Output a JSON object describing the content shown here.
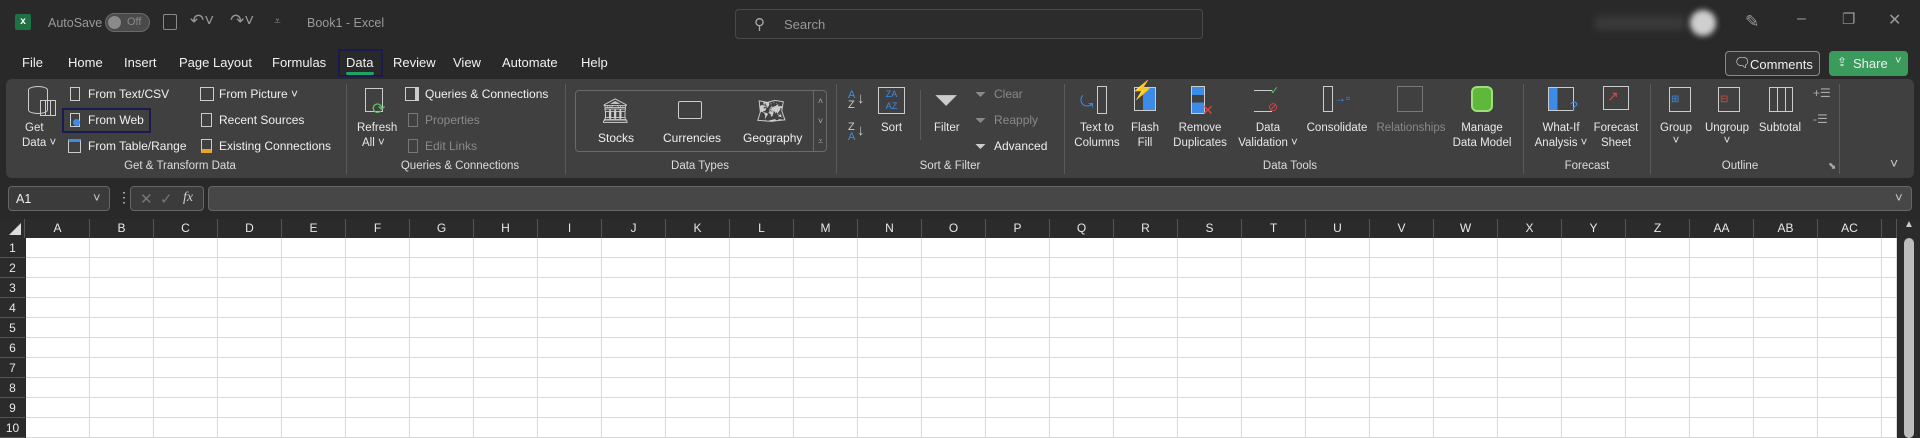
{
  "titlebar": {
    "autosave_label": "AutoSave",
    "autosave_state": "Off",
    "title": "Book1  -  Excel",
    "search_placeholder": "Search"
  },
  "menu": {
    "tabs": [
      "File",
      "Home",
      "Insert",
      "Page Layout",
      "Formulas",
      "Data",
      "Review",
      "View",
      "Automate",
      "Help"
    ],
    "active": "Data",
    "comments": "Comments",
    "share": "Share"
  },
  "ribbon": {
    "get_transform": {
      "get_data": [
        "Get",
        "Data ˅"
      ],
      "from_text_csv": "From Text/CSV",
      "from_web": "From Web",
      "from_table": "From Table/Range",
      "from_picture": "From Picture ˅",
      "recent_sources": "Recent Sources",
      "existing_connections": "Existing Connections",
      "label": "Get & Transform Data"
    },
    "queries": {
      "refresh": [
        "Refresh",
        "All ˅"
      ],
      "queries_connections": "Queries & Connections",
      "properties": "Properties",
      "edit_links": "Edit Links",
      "label": "Queries & Connections"
    },
    "data_types": {
      "stocks": "Stocks",
      "currencies": "Currencies",
      "geography": "Geography",
      "label": "Data Types"
    },
    "sort_filter": {
      "sort": "Sort",
      "filter": "Filter",
      "clear": "Clear",
      "reapply": "Reapply",
      "advanced": "Advanced",
      "label": "Sort & Filter"
    },
    "data_tools": {
      "text_to_columns": [
        "Text to",
        "Columns"
      ],
      "flash_fill": [
        "Flash",
        "Fill"
      ],
      "remove_duplicates": [
        "Remove",
        "Duplicates"
      ],
      "data_validation": [
        "Data",
        "Validation ˅"
      ],
      "consolidate": "Consolidate",
      "relationships": "Relationships",
      "manage_data_model": [
        "Manage",
        "Data Model"
      ],
      "label": "Data Tools"
    },
    "forecast": {
      "what_if": [
        "What-If",
        "Analysis ˅"
      ],
      "forecast_sheet": [
        "Forecast",
        "Sheet"
      ],
      "label": "Forecast"
    },
    "outline": {
      "group": [
        "Group",
        "˅"
      ],
      "ungroup": [
        "Ungroup",
        "˅"
      ],
      "subtotal": "Subtotal",
      "label": "Outline"
    }
  },
  "formula_bar": {
    "name_box": "A1",
    "fx": "fx",
    "value": ""
  },
  "grid": {
    "columns": [
      "A",
      "B",
      "C",
      "D",
      "E",
      "F",
      "G",
      "H",
      "I",
      "J",
      "K",
      "L",
      "M",
      "N",
      "O",
      "P",
      "Q",
      "R",
      "S",
      "T",
      "U",
      "V",
      "W",
      "X",
      "Y",
      "Z",
      "AA",
      "AB",
      "AC"
    ],
    "rows": [
      "1",
      "2",
      "3",
      "4",
      "5",
      "6",
      "7",
      "8",
      "9",
      "10"
    ]
  },
  "colors": {
    "accent": "#21a366",
    "share": "#3a9b5c",
    "highlight_box": "#1c1b4f"
  }
}
